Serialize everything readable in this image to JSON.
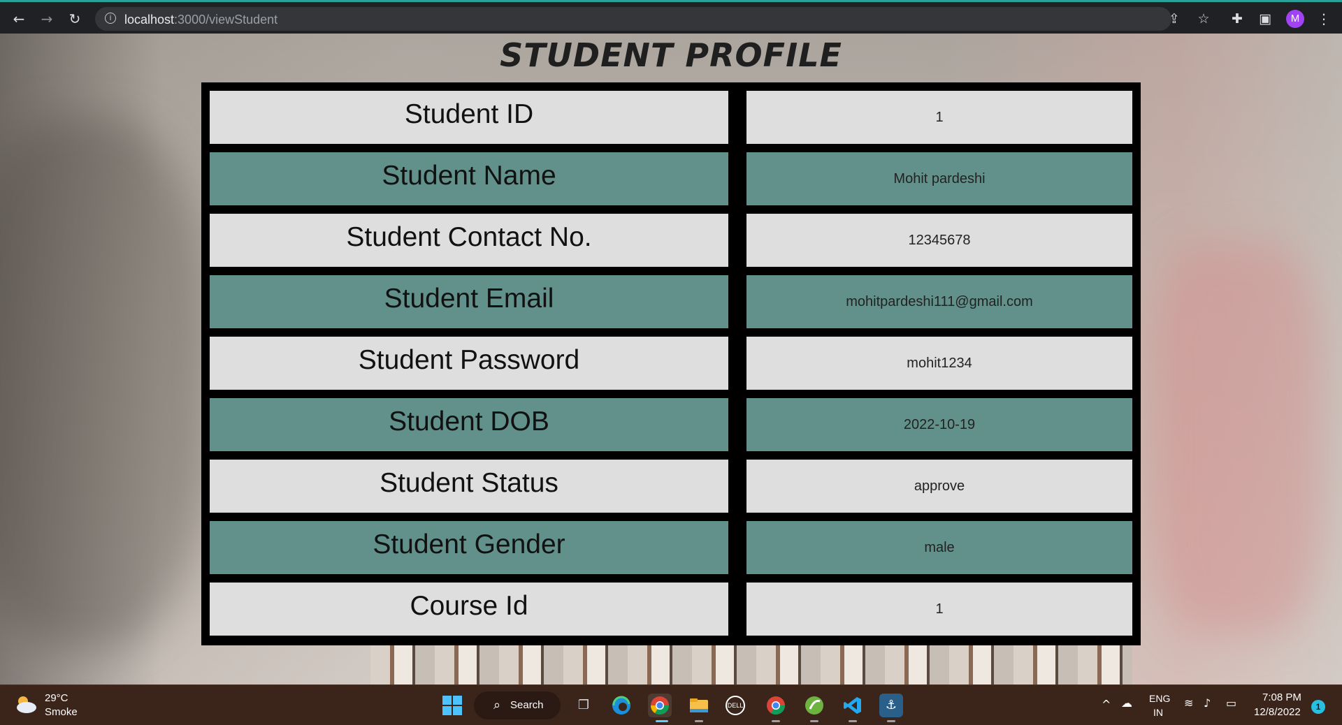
{
  "browser": {
    "url_host": "localhost",
    "url_path": ":3000/viewStudent",
    "profile_initial": "M"
  },
  "page": {
    "heading": "STUDENT PROFILE",
    "rows": [
      {
        "label": "Student ID",
        "value": "1"
      },
      {
        "label": "Student Name",
        "value": "Mohit pardeshi"
      },
      {
        "label": "Student Contact No.",
        "value": "12345678"
      },
      {
        "label": "Student Email",
        "value": "mohitpardeshi111@gmail.com"
      },
      {
        "label": "Student Password",
        "value": "mohit1234"
      },
      {
        "label": "Student DOB",
        "value": "2022-10-19"
      },
      {
        "label": "Student Status",
        "value": "approve"
      },
      {
        "label": "Student Gender",
        "value": "male"
      },
      {
        "label": "Course Id",
        "value": "1"
      }
    ]
  },
  "taskbar": {
    "weather_temp": "29°C",
    "weather_desc": "Smoke",
    "search_label": "Search",
    "lang_line1": "ENG",
    "lang_line2": "IN",
    "time": "7:08 PM",
    "date": "12/8/2022",
    "notification_count": "1"
  },
  "colors": {
    "row_light": "#dedede",
    "row_teal": "#62918b",
    "table_border": "#000000"
  }
}
